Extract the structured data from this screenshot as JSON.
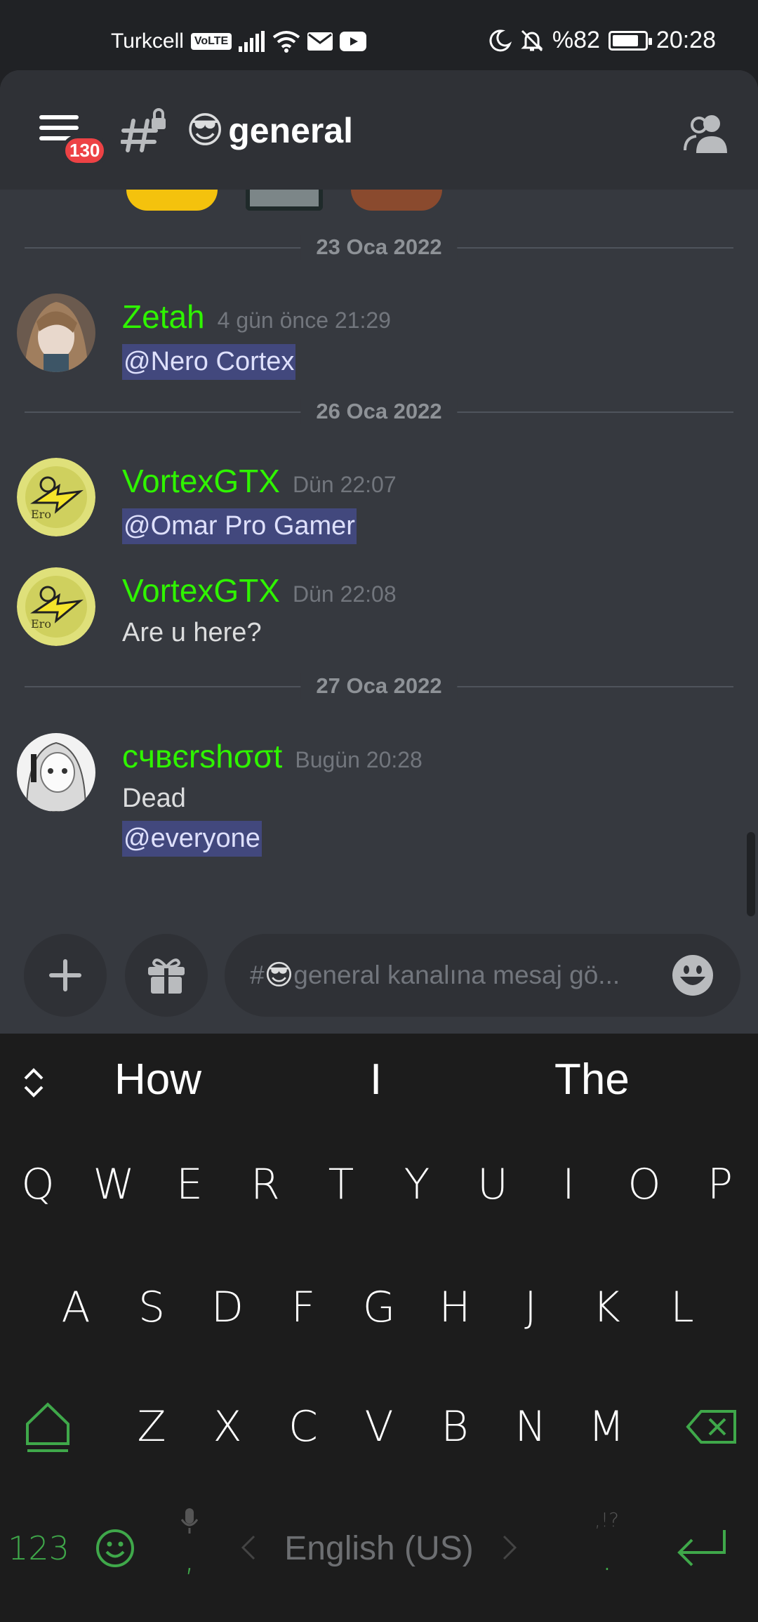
{
  "status_bar": {
    "carrier": "Turkcell",
    "volte": "VoLTE",
    "battery_pct": "%82",
    "battery_level": 0.82,
    "time": "20:28"
  },
  "header": {
    "unread_badge": "130",
    "channel_emoji": "😎",
    "channel_name": "general"
  },
  "messages": [
    {
      "type": "divider",
      "label": "23 Oca 2022"
    },
    {
      "type": "message",
      "author": "Zetah",
      "time": "4 gün önce 21:29",
      "mention": "@Nero Cortex"
    },
    {
      "type": "divider",
      "label": "26 Oca 2022"
    },
    {
      "type": "message",
      "author": "VortexGTX",
      "time": "Dün 22:07",
      "mention": "@Omar Pro Gamer"
    },
    {
      "type": "message",
      "author": "VortexGTX",
      "time": "Dün 22:08",
      "text": "Are u here?"
    },
    {
      "type": "divider",
      "label": "27 Oca 2022"
    },
    {
      "type": "message",
      "author": "cчвєrѕhσσt",
      "time": "Bugün 20:28",
      "text": "Dead",
      "mention": "@everyone"
    }
  ],
  "composer": {
    "placeholder_prefix": "#",
    "placeholder_emoji": "😎",
    "placeholder_text": "general kanalına mesaj gö..."
  },
  "keyboard": {
    "suggestions": [
      "How",
      "I",
      "The"
    ],
    "row1": [
      "Q",
      "W",
      "E",
      "R",
      "T",
      "Y",
      "U",
      "I",
      "O",
      "P"
    ],
    "row2": [
      "A",
      "S",
      "D",
      "F",
      "G",
      "H",
      "J",
      "K",
      "L"
    ],
    "row3": [
      "Z",
      "X",
      "C",
      "V",
      "B",
      "N",
      "M"
    ],
    "num_key": "123",
    "comma": ",",
    "period": ".",
    "punct_hint": ",!?",
    "language": "English (US)"
  },
  "colors": {
    "accent_green": "#2ff400",
    "keyboard_green": "#3fa84a",
    "badge_red": "#ed4245",
    "mention_bg": "#4a4f8a"
  }
}
